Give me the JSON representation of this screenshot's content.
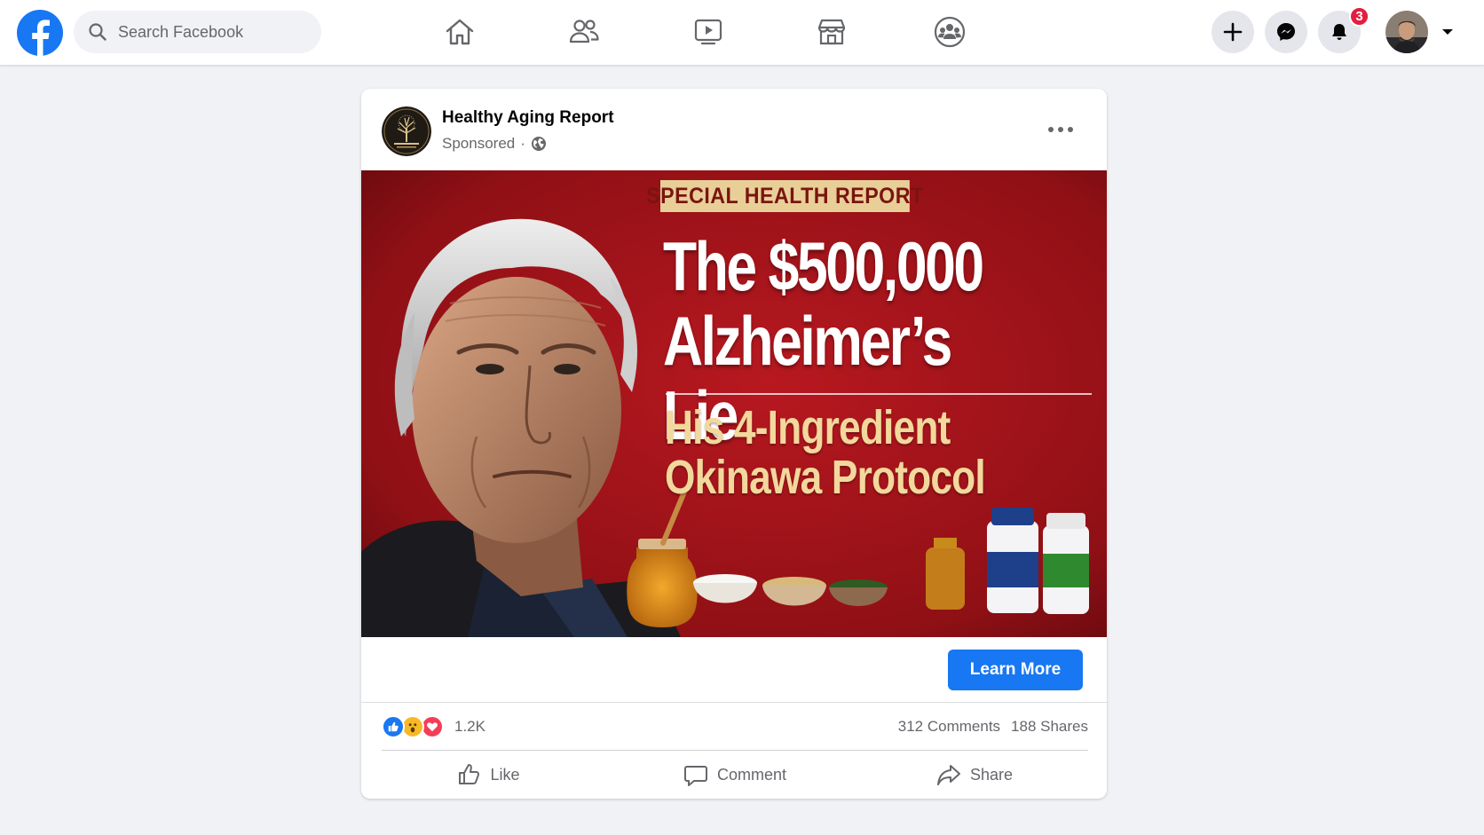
{
  "topbar": {
    "logo_icon": "facebook-logo",
    "search": {
      "placeholder": "Search Facebook",
      "icon": "search-icon"
    },
    "nav_tabs": [
      {
        "id": "home",
        "icon": "home-icon"
      },
      {
        "id": "friends",
        "icon": "friends-icon"
      },
      {
        "id": "watch",
        "icon": "video-play-icon"
      },
      {
        "id": "marketplace",
        "icon": "storefront-icon"
      },
      {
        "id": "groups",
        "icon": "groups-icon"
      }
    ],
    "actions": [
      {
        "id": "create",
        "icon": "plus-icon"
      },
      {
        "id": "messenger",
        "icon": "messenger-icon"
      },
      {
        "id": "notifications",
        "icon": "bell-icon"
      }
    ],
    "notification_count": "3",
    "account_caret": "caret-down-icon"
  },
  "post": {
    "page_name": "Healthy Aging Report",
    "sponsored_label": "Sponsored",
    "separator": "·",
    "privacy_icon": "globe-icon",
    "more_icon": "more-options-icon",
    "ad": {
      "kicker": "SPECIAL HEALTH REPORT",
      "headline": "The $500,000\nAlzheimer’s Lie",
      "subhead": "His 4-Ingredient\nOkinawa Protocol",
      "background_color": "#a3141a"
    },
    "cta_label": "Learn More",
    "reactions": [
      "like",
      "wow",
      "love"
    ],
    "reaction_count": "1.2K",
    "comments": "312 Comments",
    "shares": "188 Shares",
    "action_buttons": {
      "like": "Like",
      "comment": "Comment",
      "share": "Share"
    }
  },
  "colors": {
    "brand_blue": "#1877f2",
    "page_bg": "#f0f2f5",
    "badge_red": "#e41e3f",
    "muted_text": "#65676b"
  }
}
